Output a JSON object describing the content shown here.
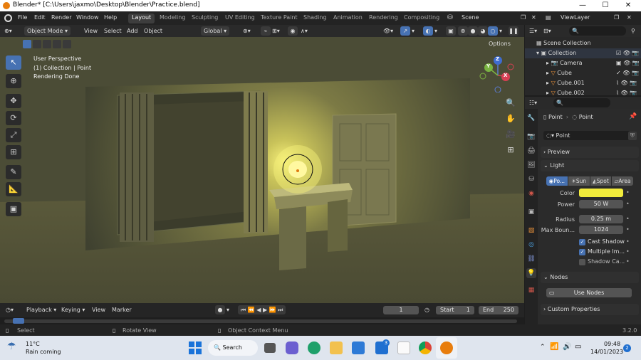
{
  "titlebar": {
    "title": "Blender* [C:\\Users\\jaxmo\\Desktop\\Blender\\Practice.blend]",
    "minimize": "—",
    "maximize": "☐",
    "close": "✕"
  },
  "menu": {
    "file": "File",
    "edit": "Edit",
    "render": "Render",
    "window": "Window",
    "help": "Help"
  },
  "workspaces": [
    "Layout",
    "Modeling",
    "Sculpting",
    "UV Editing",
    "Texture Paint",
    "Shading",
    "Animation",
    "Rendering",
    "Compositing"
  ],
  "scene": {
    "label": "Scene",
    "viewlayer": "ViewLayer"
  },
  "viewport_header": {
    "mode": "Object Mode",
    "view": "View",
    "select": "Select",
    "add": "Add",
    "object": "Object",
    "orientation": "Global",
    "options": "Options"
  },
  "viewport_overlay": {
    "line1": "User Perspective",
    "line2": "(1) Collection | Point",
    "line3": "Rendering Done"
  },
  "gizmo": {
    "z": "Z",
    "y": "Y",
    "x": "X"
  },
  "timeline": {
    "playback": "Playback",
    "keying": "Keying",
    "view": "View",
    "marker": "Marker",
    "current_frame": "1",
    "start_label": "Start",
    "start": "1",
    "end_label": "End",
    "end": "250"
  },
  "statusbar": {
    "select": "Select",
    "rotate": "Rotate View",
    "context": "Object Context Menu",
    "version": "3.2.0"
  },
  "outliner": {
    "search_placeholder": "",
    "scene_collection": "Scene Collection",
    "collection": "Collection",
    "items": [
      "Camera",
      "Cube",
      "Cube.001",
      "Cube.002"
    ]
  },
  "properties": {
    "breadcrumb_object": "Point",
    "breadcrumb_data": "Point",
    "datablock": "Point",
    "preview": "Preview",
    "light": "Light",
    "light_types": [
      "Po...",
      "Sun",
      "Spot",
      "Area"
    ],
    "color_label": "Color",
    "color_value": "#f2ec3c",
    "power_label": "Power",
    "power": "50 W",
    "radius_label": "Radius",
    "radius": "0.25 m",
    "max_bounces_label": "Max Boun...",
    "max_bounces": "1024",
    "cast_shadow": "Cast Shadow",
    "multiple_importance": "Multiple Im...",
    "shadow_caustics": "Shadow Ca...",
    "nodes": "Nodes",
    "use_nodes": "Use Nodes",
    "custom_properties": "Custom Properties"
  },
  "taskbar": {
    "temp": "11°C",
    "weather": "Rain coming",
    "search": "Search",
    "time": "09:48",
    "date": "14/01/2023",
    "notifications": "2",
    "teams_badge": "3"
  }
}
